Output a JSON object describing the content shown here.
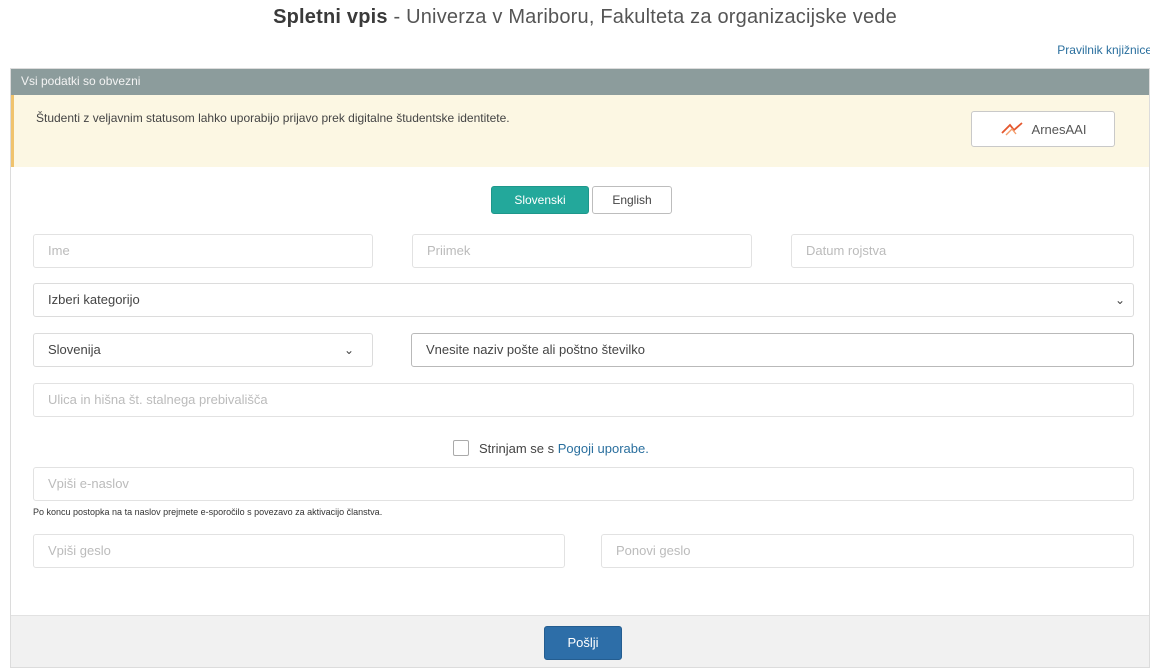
{
  "header": {
    "title_bold": "Spletni vpis",
    "title_rest": " - Univerza v Mariboru, Fakulteta za organizacijske vede",
    "rules_link": "Pravilnik knjižnice"
  },
  "form": {
    "header_note": "Vsi podatki so obvezni",
    "notice_text": "Študenti z veljavnim statusom lahko uporabijo prijavo prek digitalne študentske identitete.",
    "aai_button": "ArnesAAI",
    "lang_active": "Slovenski",
    "lang_other": "English",
    "fields": {
      "first_name": "Ime",
      "last_name": "Priimek",
      "birth_date": "Datum rojstva",
      "category": "Izberi kategorijo",
      "country": "Slovenija",
      "post": "Vnesite naziv pošte ali poštno številko",
      "street": "Ulica in hišna št. stalnega prebivališča",
      "email": "Vpiši e-naslov",
      "password": "Vpiši geslo",
      "password_repeat": "Ponovi geslo"
    },
    "terms_prefix": "Strinjam se s",
    "terms_link": "Pogoji uporabe.",
    "email_note": "Po koncu postopka na ta naslov prejmete e-sporočilo s povezavo za aktivacijo članstva.",
    "submit": "Pošlji"
  },
  "colors": {
    "header_bar": "#8c9c9c",
    "notice_bg": "#fcf7e3",
    "lang_active": "#23a89b",
    "submit": "#2d6ea8",
    "link": "#2a6f9e"
  }
}
